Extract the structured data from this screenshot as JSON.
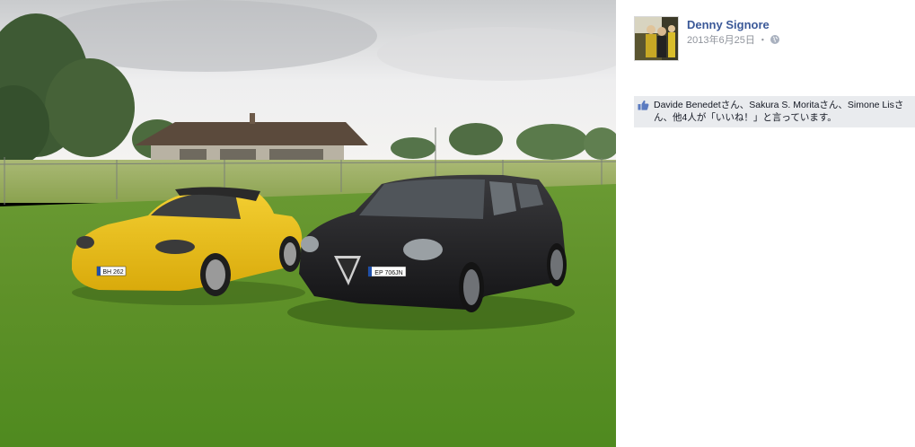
{
  "post": {
    "author": "Denny Signore",
    "date": "2013年6月25日",
    "separator": "・",
    "audience_icon": "globe-icon"
  },
  "likes": {
    "icon": "thumbs-up-icon",
    "text": "Davide Benedetさん、Sakura S. Moritaさん、Simone Lisさん、他4人が「いいね！」と言っています。"
  },
  "photo": {
    "plate_left": "BH 262",
    "plate_right": "EP 706JN"
  },
  "colors": {
    "link": "#3b5998",
    "likes_bg": "#e9ebee",
    "meta": "#90949c"
  }
}
